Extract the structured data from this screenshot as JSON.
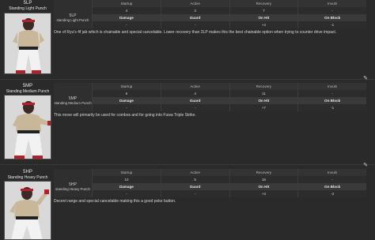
{
  "columns": {
    "startup": "Startup",
    "active": "Active",
    "recovery": "Recovery",
    "invuln": "Invuln",
    "damage": "Damage",
    "guard": "Guard",
    "on_hit": "On Hit",
    "on_block": "On Block"
  },
  "icons": {
    "edit": "pencil-icon"
  },
  "moves": [
    {
      "code": "5LP",
      "name": "Standing Light Punch",
      "short_code": "5LP",
      "short_name": "standing Light Punch",
      "startup": "4",
      "active": "3",
      "recovery": "7",
      "invuln": "-",
      "damage": "-",
      "guard": "-",
      "on_hit": "+4",
      "on_block": "-1",
      "description": "One of Ryu's 4f jab which is chainable and special cancelable. Lower recovery than 2LP makes this the best chainable option when trying to counter drive impact."
    },
    {
      "code": "5MP",
      "name": "Standing Medium Punch",
      "short_code": "5MP",
      "short_name": "standing Medium Punch",
      "startup": "6",
      "active": "4",
      "recovery": "11",
      "invuln": "-",
      "damage": "-",
      "guard": "-",
      "on_hit": "+7",
      "on_block": "-1",
      "description": "This move will primarily be used for combos and for going into Fuwa Triple Strike."
    },
    {
      "code": "5HP",
      "name": "Standing Heavy Punch",
      "short_code": "5HP",
      "short_name": "standing Heavy Punch",
      "startup": "10",
      "active": "5",
      "recovery": "18",
      "invuln": "-",
      "damage": "-",
      "guard": "-",
      "on_hit": "+3",
      "on_block": "-2",
      "description": "Decent range and special cancelable making this a good poke button."
    }
  ]
}
